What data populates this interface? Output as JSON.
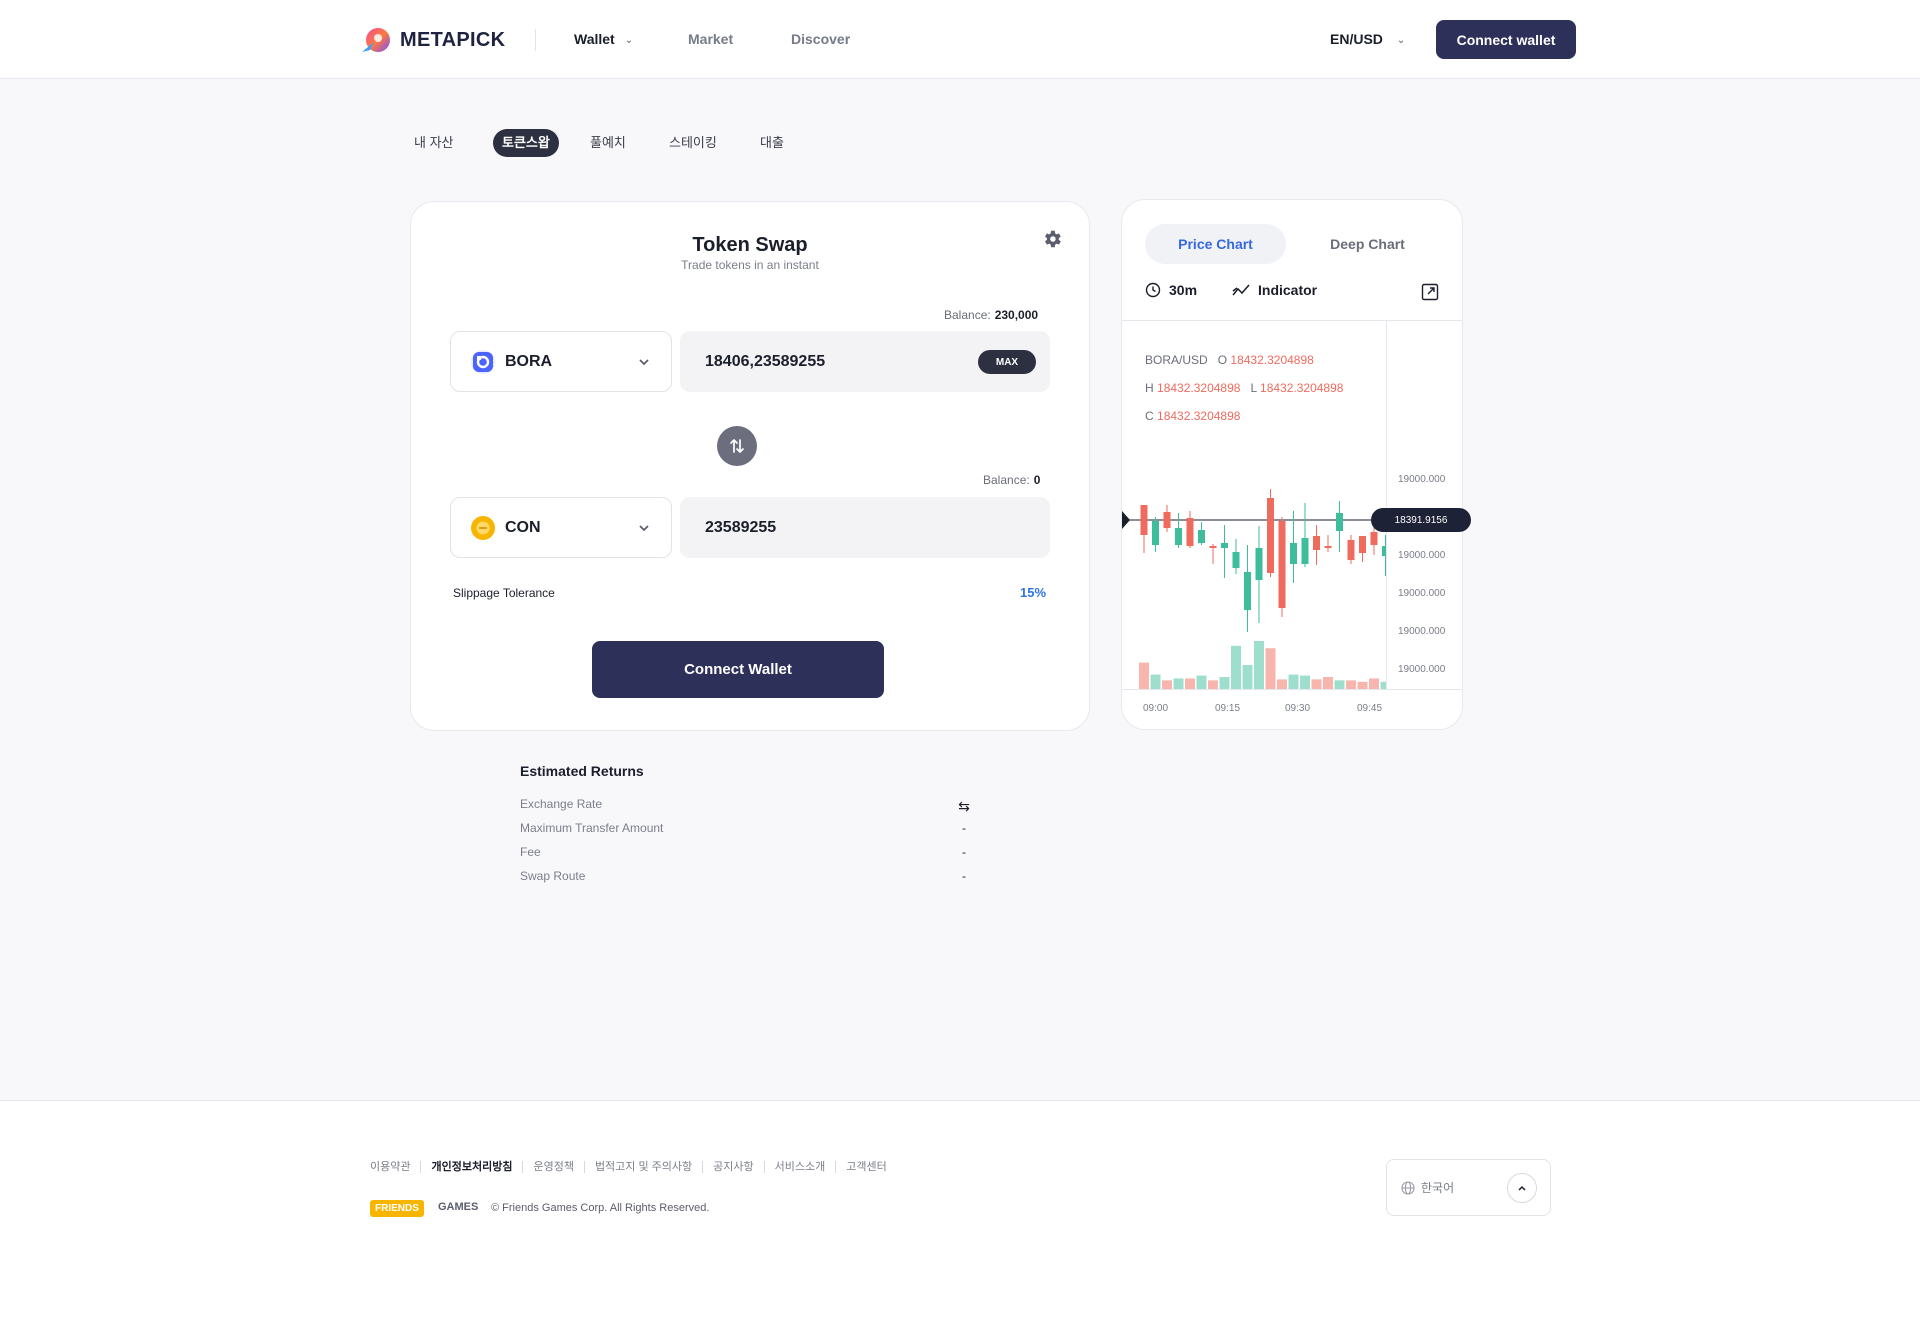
{
  "header": {
    "logo_text": "METAPICK",
    "nav": [
      {
        "label": "Wallet",
        "active": true
      },
      {
        "label": "Market",
        "active": false
      },
      {
        "label": "Discover",
        "active": false
      }
    ],
    "locale": "EN/USD",
    "connect_label": "Connect wallet"
  },
  "tabs": [
    "내 자산",
    "토큰스왑",
    "풀예치",
    "스테이킹",
    "대출"
  ],
  "swap": {
    "title": "Token Swap",
    "subtitle": "Trade tokens in an instant",
    "from": {
      "balance_label": "Balance:",
      "balance": "230,000",
      "token": "BORA",
      "amount": "18406,23589255",
      "max_label": "MAX"
    },
    "to": {
      "balance_label": "Balance:",
      "balance": "0",
      "token": "CON",
      "amount": "23589255"
    },
    "slippage_label": "Slippage Tolerance",
    "slippage_value": "15%",
    "connect_label": "Connect Wallet",
    "icons": {
      "settings": "gear-icon",
      "swap": "swap-arrows-icon"
    }
  },
  "estimated": {
    "title": "Estimated Returns",
    "rows": [
      {
        "label": "Exchange Rate",
        "value": "⇆"
      },
      {
        "label": "Maximum Transfer Amount",
        "value": "-"
      },
      {
        "label": "Fee",
        "value": "-"
      },
      {
        "label": "Swap Route",
        "value": "-"
      }
    ]
  },
  "chart_panel": {
    "tabs": [
      "Price Chart",
      "Deep Chart"
    ],
    "interval": "30m",
    "indicator_label": "Indicator",
    "ohlc": {
      "pair": "BORA/USD",
      "o_label": "O",
      "o": "18432.3204898",
      "h_label": "H",
      "h": "18432.3204898",
      "l_label": "L",
      "l": "18432.3204898",
      "c_label": "C",
      "c": "18432.3204898"
    },
    "current_price": "18391.9156",
    "colors": {
      "up": "#3dbd9b",
      "down": "#ef6b5e"
    }
  },
  "chart_data": {
    "type": "candlestick",
    "x_ticks": [
      "09:00",
      "09:15",
      "09:30",
      "09:45"
    ],
    "y_ticks": [
      "19000.000",
      "19000.000",
      "19000.000",
      "19000.000",
      "19000.000",
      "19000.000"
    ],
    "candles": [
      {
        "o": 45,
        "c": 75,
        "h": 68,
        "l": 93,
        "up": false
      },
      {
        "o": 85,
        "c": 61,
        "h": 57,
        "l": 92,
        "up": true
      },
      {
        "o": 52,
        "c": 68,
        "h": 45,
        "l": 72,
        "up": false
      },
      {
        "o": 68,
        "c": 85,
        "h": 53,
        "l": 88,
        "up": true
      },
      {
        "o": 58,
        "c": 86,
        "h": 51,
        "l": 88,
        "up": false
      },
      {
        "o": 83,
        "c": 70,
        "h": 62,
        "l": 85,
        "up": true
      },
      {
        "o": 86,
        "c": 88,
        "h": 84,
        "l": 104,
        "up": false
      },
      {
        "o": 88,
        "c": 83,
        "h": 65,
        "l": 118,
        "up": true
      },
      {
        "o": 108,
        "c": 92,
        "h": 79,
        "l": 114,
        "up": true
      },
      {
        "o": 112,
        "c": 150,
        "h": 85,
        "l": 172,
        "up": true
      },
      {
        "o": 120,
        "c": 88,
        "h": 66,
        "l": 163,
        "up": true
      },
      {
        "o": 38,
        "c": 113,
        "h": 29,
        "l": 117,
        "up": false
      },
      {
        "o": 61,
        "c": 148,
        "h": 57,
        "l": 157,
        "up": false
      },
      {
        "o": 83,
        "c": 104,
        "h": 51,
        "l": 123,
        "up": true
      },
      {
        "o": 104,
        "c": 78,
        "h": 43,
        "l": 107,
        "up": true
      },
      {
        "o": 76,
        "c": 90,
        "h": 65,
        "l": 105,
        "up": false
      },
      {
        "o": 87,
        "c": 86,
        "h": 75,
        "l": 92,
        "up": false
      },
      {
        "o": 53,
        "c": 71,
        "h": 41,
        "l": 92,
        "up": true
      },
      {
        "o": 80,
        "c": 100,
        "h": 75,
        "l": 104,
        "up": false
      },
      {
        "o": 93,
        "c": 76,
        "h": 86,
        "l": 102,
        "up": false
      },
      {
        "o": 72,
        "c": 85,
        "h": 58,
        "l": 95,
        "up": false
      },
      {
        "o": 86,
        "c": 96,
        "h": 75,
        "l": 116,
        "up": true
      },
      {
        "o": 96,
        "c": 110,
        "h": 87,
        "l": 112,
        "up": false
      }
    ],
    "volumes": [
      55,
      30,
      18,
      22,
      22,
      28,
      18,
      25,
      90,
      50,
      100,
      85,
      20,
      30,
      28,
      20,
      25,
      18,
      18,
      15,
      22,
      15,
      18
    ]
  },
  "footer": {
    "links": [
      "이용약관",
      "개인정보처리방침",
      "운영정책",
      "법적고지 및 주의사항",
      "공지사항",
      "서비스소개",
      "고객센터"
    ],
    "brand_badge": "FRIENDS",
    "brand_text": "GAMES",
    "copyright": "© Friends Games Corp. All Rights Reserved.",
    "language": "한국어"
  }
}
